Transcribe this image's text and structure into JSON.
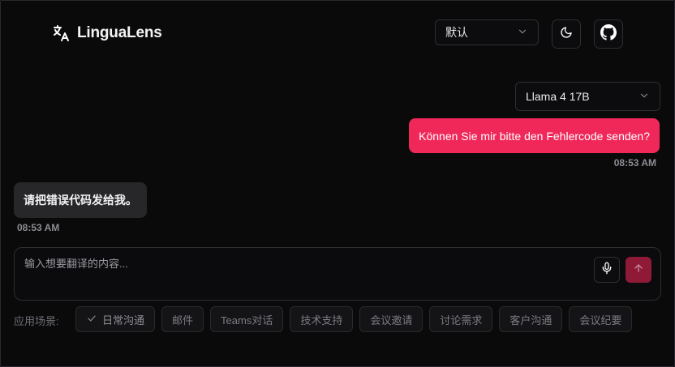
{
  "header": {
    "brand_name": "LinguaLens",
    "language_select_value": "默认"
  },
  "model_select": {
    "value": "Llama 4 17B"
  },
  "messages": {
    "user_text": "Können Sie mir bitte den Fehlercode senden?",
    "user_time": "08:53 AM",
    "bot_text": "请把错误代码发给我。",
    "bot_time": "08:53 AM"
  },
  "input": {
    "placeholder": "输入想要翻译的内容..."
  },
  "scenarios": {
    "label": "应用场景:",
    "chips": [
      "日常沟通",
      "邮件",
      "Teams对话",
      "技术支持",
      "会议邀请",
      "讨论需求",
      "客户沟通",
      "会议纪要"
    ]
  },
  "colors": {
    "accent": "#f0285a",
    "send_button": "#8f1a38",
    "background": "#0a0a0b"
  }
}
